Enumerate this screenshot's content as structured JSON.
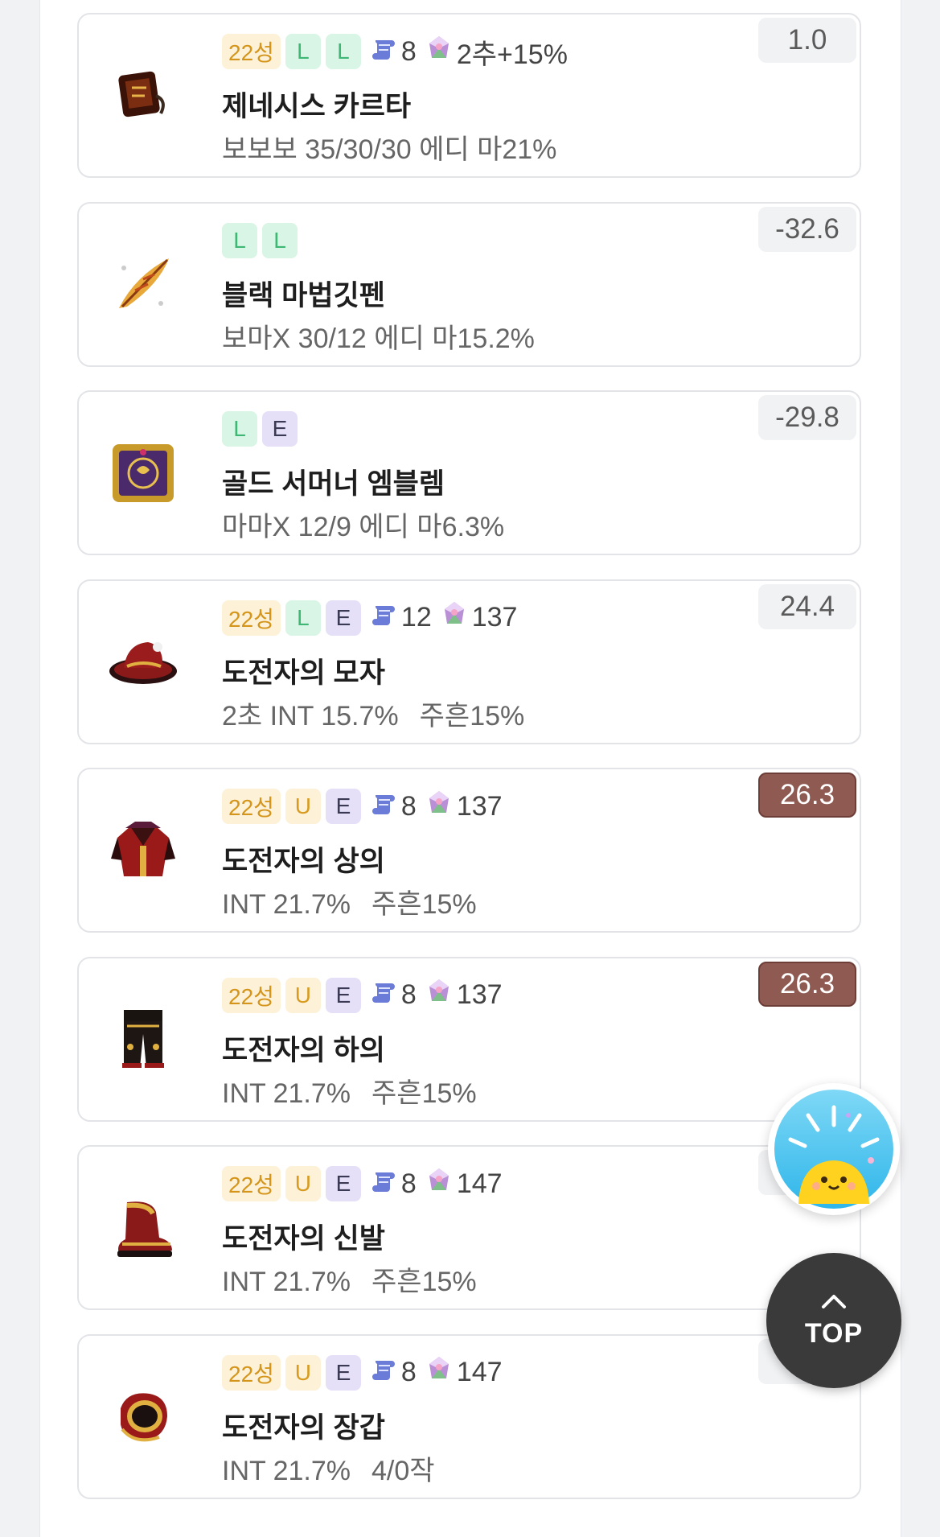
{
  "items": [
    {
      "star": "22성",
      "potential": [
        "L",
        "L"
      ],
      "scroll": "8",
      "flame": "2추+15%",
      "name": "제네시스 카르타",
      "options": [
        "보보보 35/30/30 에디 마21%"
      ],
      "score": "1.0",
      "score_highlight": false,
      "icon": "genesis-karta-icon"
    },
    {
      "star": "",
      "potential": [
        "L",
        "L"
      ],
      "scroll": "",
      "flame": "",
      "name": "블랙 마법깃펜",
      "options": [
        "보마X 30/12 에디 마15.2%"
      ],
      "score": "-32.6",
      "score_highlight": false,
      "icon": "magic-quill-icon"
    },
    {
      "star": "",
      "potential": [
        "L",
        "E"
      ],
      "scroll": "",
      "flame": "",
      "name": "골드 서머너 엠블렘",
      "options": [
        "마마X 12/9 에디 마6.3%"
      ],
      "score": "-29.8",
      "score_highlight": false,
      "icon": "emblem-icon"
    },
    {
      "star": "22성",
      "potential": [
        "L",
        "E"
      ],
      "scroll": "12",
      "flame": "137",
      "name": "도전자의 모자",
      "options": [
        "2초 INT 15.7%",
        "주흔15%"
      ],
      "score": "24.4",
      "score_highlight": false,
      "icon": "hat-icon"
    },
    {
      "star": "22성",
      "potential": [
        "U",
        "E"
      ],
      "scroll": "8",
      "flame": "137",
      "name": "도전자의 상의",
      "options": [
        "INT 21.7%",
        "주흔15%"
      ],
      "score": "26.3",
      "score_highlight": true,
      "icon": "top-armor-icon"
    },
    {
      "star": "22성",
      "potential": [
        "U",
        "E"
      ],
      "scroll": "8",
      "flame": "137",
      "name": "도전자의 하의",
      "options": [
        "INT 21.7%",
        "주흔15%"
      ],
      "score": "26.3",
      "score_highlight": true,
      "icon": "bottom-armor-icon"
    },
    {
      "star": "22성",
      "potential": [
        "U",
        "E"
      ],
      "scroll": "8",
      "flame": "147",
      "name": "도전자의 신발",
      "options": [
        "INT 21.7%",
        "주흔15%"
      ],
      "score": "",
      "score_highlight": false,
      "icon": "shoes-icon"
    },
    {
      "star": "22성",
      "potential": [
        "U",
        "E"
      ],
      "scroll": "8",
      "flame": "147",
      "name": "도전자의 장갑",
      "options": [
        "INT 21.7%",
        "4/0작"
      ],
      "score": "",
      "score_highlight": false,
      "icon": "gloves-icon"
    }
  ],
  "top_button": {
    "label": "TOP",
    "icon": "chevron-up-icon"
  },
  "event_button": {
    "icon": "sun-character-icon"
  }
}
